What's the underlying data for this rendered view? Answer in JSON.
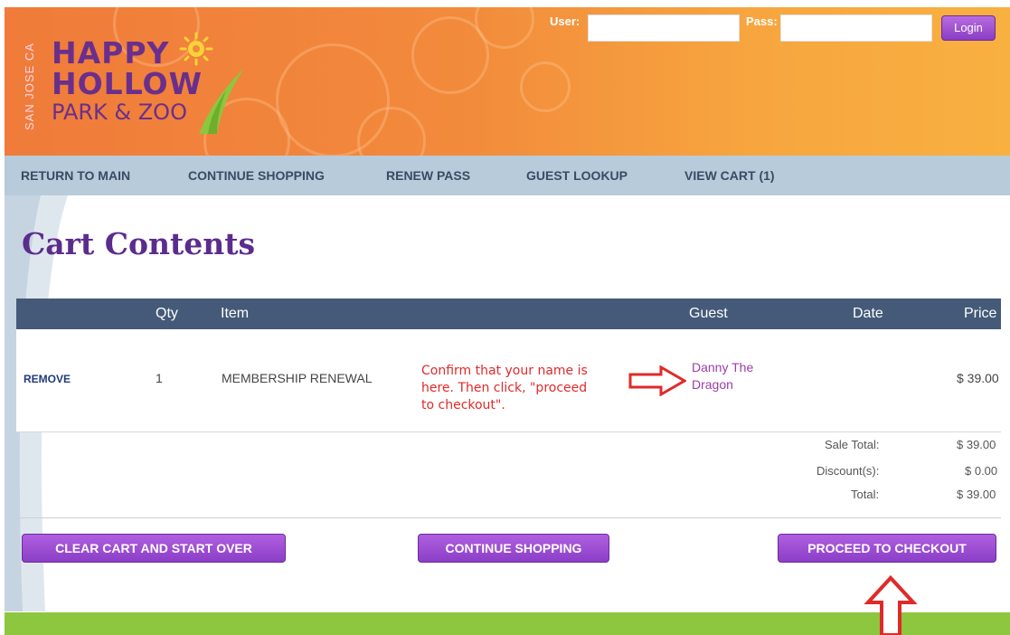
{
  "header": {
    "logo": {
      "line1": "HAPPY",
      "line2": "HOLLOW",
      "line3": "PARK & ZOO",
      "side_text": "SAN JOSE CA"
    },
    "login": {
      "user_label": "User:",
      "pass_label": "Pass:",
      "user_value": "",
      "pass_value": "",
      "button_label": "Login"
    }
  },
  "nav": {
    "items": [
      {
        "label": "RETURN TO MAIN"
      },
      {
        "label": "CONTINUE SHOPPING"
      },
      {
        "label": "RENEW PASS"
      },
      {
        "label": "GUEST LOOKUP"
      },
      {
        "label": "VIEW CART (1)"
      }
    ]
  },
  "page_title": "Cart Contents",
  "table": {
    "columns": [
      "",
      "Qty",
      "Item",
      "Guest",
      "Date",
      "Price"
    ],
    "rows": [
      {
        "action": "REMOVE",
        "qty": "1",
        "item": "MEMBERSHIP RENEWAL",
        "guest_line1": "Danny The",
        "guest_line2": "Dragon",
        "date": "",
        "price": "$ 39.00"
      }
    ]
  },
  "annotation": {
    "text": "Confirm that your name is here. Then click, \"proceed to checkout\".",
    "color": "#e02a2a"
  },
  "totals": {
    "sale_total_label": "Sale Total:",
    "sale_total_value": "$ 39.00",
    "discount_label": "Discount(s):",
    "discount_value": "$ 0.00",
    "total_label": "Total:",
    "total_value": "$ 39.00"
  },
  "actions": {
    "clear_cart": "CLEAR CART AND START OVER",
    "continue_shopping": "CONTINUE SHOPPING",
    "proceed_checkout": "PROCEED TO CHECKOUT"
  },
  "colors": {
    "header_orange": "#f07b3a",
    "nav_blue": "#b7cbdb",
    "table_header": "#445a78",
    "title_purple": "#5b2c8e",
    "button_purple": "#8b3fc7",
    "footer_green": "#8dc63f",
    "arrow_red": "#e02a2a"
  }
}
